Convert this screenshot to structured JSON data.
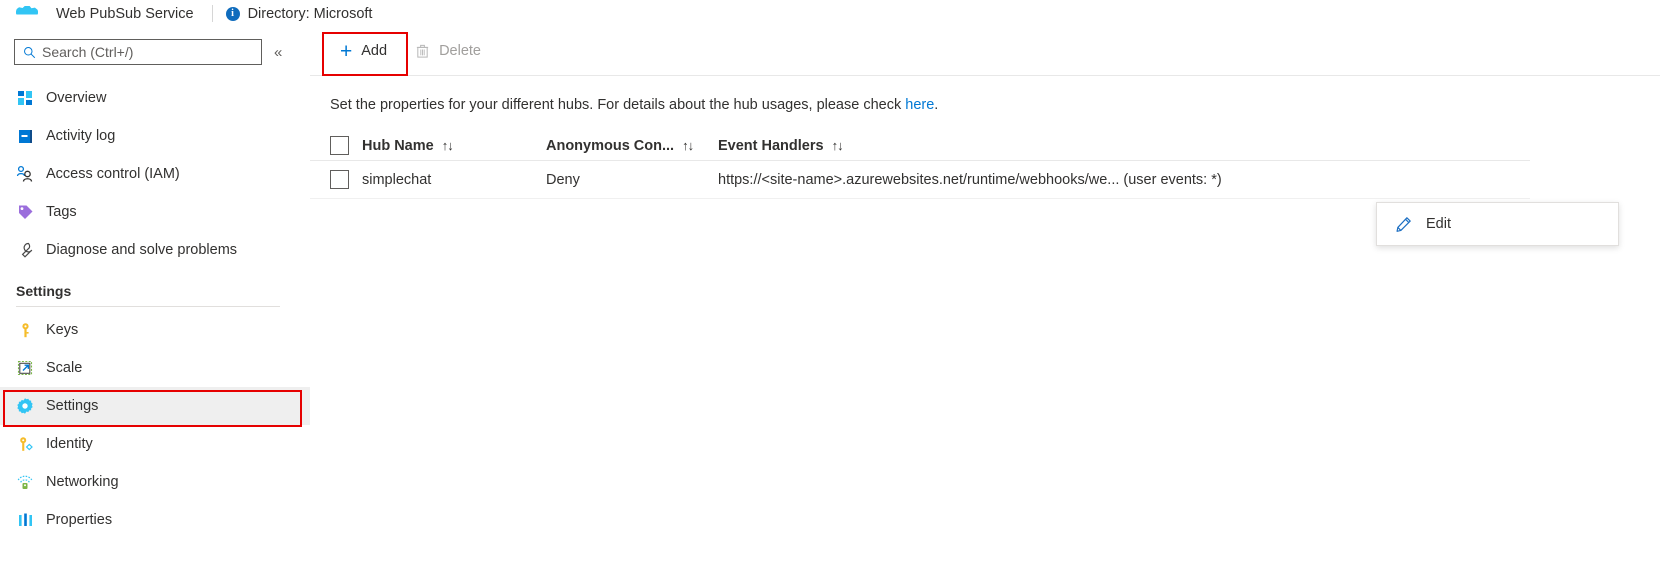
{
  "topbar": {
    "logo_icon": "web-pubsub-cloud-icon",
    "service_title": "Web PubSub Service",
    "info_icon": "info-icon",
    "directory_text": "Directory: Microsoft"
  },
  "sidebar": {
    "search": {
      "icon": "search-icon",
      "placeholder": "Search (Ctrl+/)",
      "value": ""
    },
    "collapse_icon": "double-chevron-left-icon",
    "items": [
      {
        "label": "Overview",
        "icon": "overview-grid-icon",
        "selected": false
      },
      {
        "label": "Activity log",
        "icon": "activity-log-icon",
        "selected": false
      },
      {
        "label": "Access control (IAM)",
        "icon": "access-control-people-icon",
        "selected": false
      },
      {
        "label": "Tags",
        "icon": "tag-icon",
        "selected": false
      },
      {
        "label": "Diagnose and solve problems",
        "icon": "wrench-icon",
        "selected": false
      }
    ],
    "group_header": "Settings",
    "settings_items": [
      {
        "label": "Keys",
        "icon": "key-icon",
        "selected": false
      },
      {
        "label": "Scale",
        "icon": "scale-arrow-icon",
        "selected": false
      },
      {
        "label": "Settings",
        "icon": "gear-icon",
        "selected": true
      },
      {
        "label": "Identity",
        "icon": "identity-key-icon",
        "selected": false
      },
      {
        "label": "Networking",
        "icon": "networking-icon",
        "selected": false
      },
      {
        "label": "Properties",
        "icon": "properties-bars-icon",
        "selected": false
      }
    ]
  },
  "toolbar": {
    "add_label": "Add",
    "add_icon": "plus-icon",
    "delete_label": "Delete",
    "delete_icon": "trash-icon",
    "delete_disabled": true
  },
  "main": {
    "description_prefix": "Set the properties for your different hubs. For details about the hub usages, please check ",
    "description_link": "here",
    "description_suffix": ".",
    "table": {
      "columns": [
        {
          "label": "Hub Name",
          "sort_icon": "sort-up-down-icon"
        },
        {
          "label": "Anonymous Con...",
          "sort_icon": "sort-up-down-icon"
        },
        {
          "label": "Event Handlers",
          "sort_icon": "sort-up-down-icon"
        }
      ],
      "rows": [
        {
          "hub_name": "simplechat",
          "anonymous_connect": "Deny",
          "event_handlers": "https://<site-name>.azurewebsites.net/runtime/webhooks/we... (user events: *)",
          "more_icon": "ellipsis-icon"
        }
      ]
    }
  },
  "context_menu": {
    "items": [
      {
        "label": "Edit",
        "icon": "pencil-edit-icon"
      }
    ]
  },
  "annotations": {
    "highlight_color": "#e60000",
    "boxes": [
      {
        "target": "sidebar-item-settings"
      },
      {
        "target": "add-button"
      }
    ]
  }
}
